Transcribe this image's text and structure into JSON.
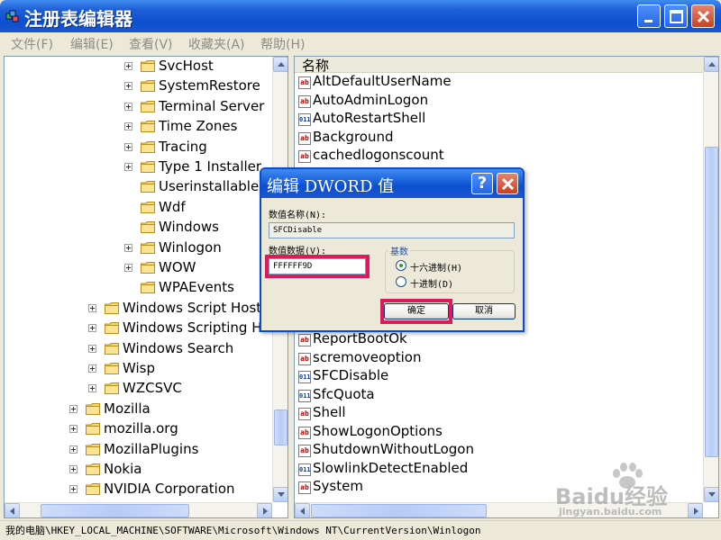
{
  "window": {
    "title": "注册表编辑器"
  },
  "menu": [
    "文件(F)",
    "编辑(E)",
    "查看(V)",
    "收藏夹(A)",
    "帮助(H)"
  ],
  "tree": {
    "items": [
      {
        "label": "SvcHost",
        "expander": true
      },
      {
        "label": "SystemRestore",
        "expander": true
      },
      {
        "label": "Terminal Server",
        "expander": true
      },
      {
        "label": "Time Zones",
        "expander": true
      },
      {
        "label": "Tracing",
        "expander": true
      },
      {
        "label": "Type 1 Installer",
        "expander": true
      },
      {
        "label": "Userinstallable.d",
        "expander": false
      },
      {
        "label": "Wdf",
        "expander": false
      },
      {
        "label": "Windows",
        "expander": false
      },
      {
        "label": "Winlogon",
        "expander": true
      },
      {
        "label": "WOW",
        "expander": true
      },
      {
        "label": "WPAEvents",
        "expander": false
      },
      {
        "label": "Windows Script Host",
        "expander": true
      },
      {
        "label": "Windows Scripting Hos",
        "expander": true
      },
      {
        "label": "Windows Search",
        "expander": true
      },
      {
        "label": "Wisp",
        "expander": true
      },
      {
        "label": "WZCSVC",
        "expander": true
      },
      {
        "label": "Mozilla",
        "expander": true
      },
      {
        "label": "mozilla.org",
        "expander": true
      },
      {
        "label": "MozillaPlugins",
        "expander": true
      },
      {
        "label": "Nokia",
        "expander": true
      },
      {
        "label": "NVIDIA Corporation",
        "expander": true
      }
    ]
  },
  "list": {
    "header": "名称",
    "items": [
      {
        "type": "sz",
        "name": "AltDefaultUserName"
      },
      {
        "type": "sz",
        "name": "AutoAdminLogon"
      },
      {
        "type": "dword",
        "name": "AutoRestartShell"
      },
      {
        "type": "sz",
        "name": "Background"
      },
      {
        "type": "sz",
        "name": "cachedlogonscount"
      },
      {
        "type": "sz",
        "name": "ReportBootOk"
      },
      {
        "type": "sz",
        "name": "scremoveoption"
      },
      {
        "type": "dword",
        "name": "SFCDisable"
      },
      {
        "type": "dword",
        "name": "SfcQuota"
      },
      {
        "type": "sz",
        "name": "Shell"
      },
      {
        "type": "sz",
        "name": "ShowLogonOptions"
      },
      {
        "type": "sz",
        "name": "ShutdownWithoutLogon"
      },
      {
        "type": "dword",
        "name": "SlowlinkDetectEnabled"
      },
      {
        "type": "sz",
        "name": "System"
      }
    ]
  },
  "status": {
    "path": "我的电脑\\HKEY_LOCAL_MACHINE\\SOFTWARE\\Microsoft\\Windows NT\\CurrentVersion\\Winlogon"
  },
  "dialog": {
    "title": "编辑 DWORD 值",
    "help_glyph": "?",
    "name_label": "数值名称(N):",
    "name_value": "SFCDisable",
    "data_label": "数值数据(V):",
    "data_value": "FFFFFF9D",
    "base_label": "基数",
    "hex_label": "十六进制(H)",
    "dec_label": "十进制(D)",
    "selected_base": "hex",
    "ok_label": "确定",
    "cancel_label": "取消",
    "highlight_color": "#e0185c"
  },
  "watermark": {
    "brand": "Baidu经验",
    "url": "jingyan.baidu.com"
  },
  "colors": {
    "titlebar": "#0b4fd0",
    "close_button": "#c8421f"
  }
}
